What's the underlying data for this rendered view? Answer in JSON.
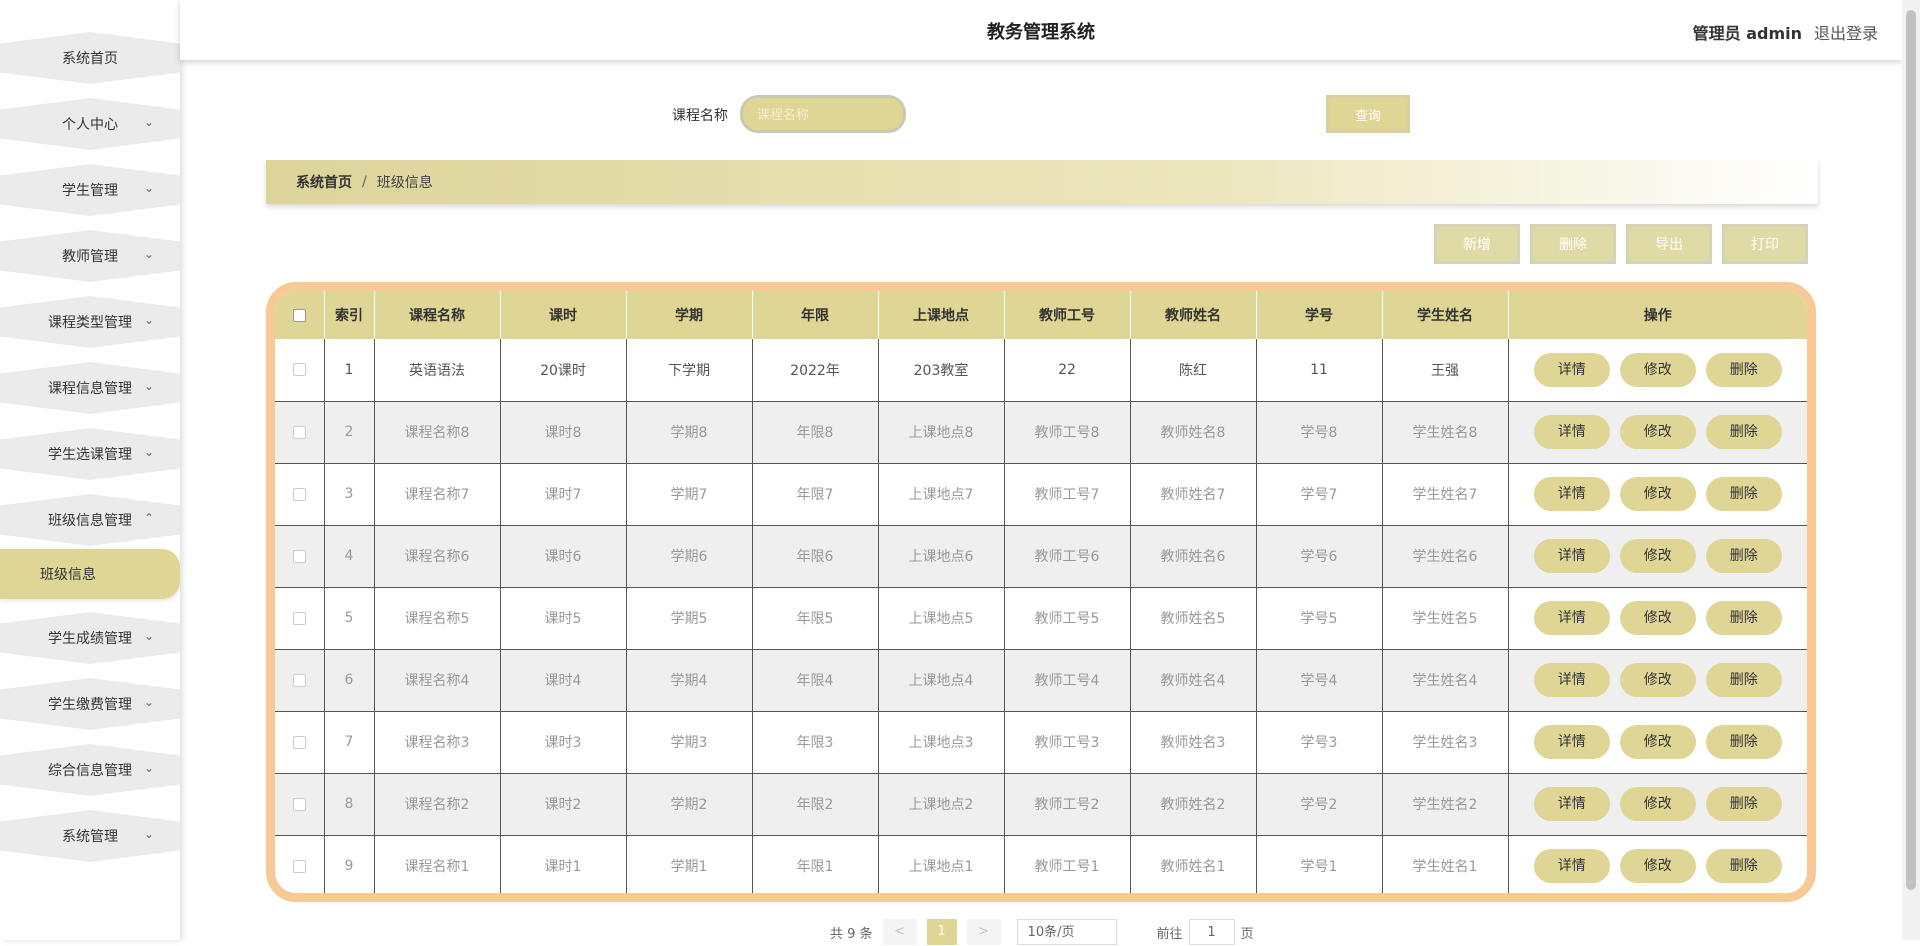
{
  "header": {
    "title": "教务管理系统",
    "admin": "管理员 admin",
    "logout": "退出登录"
  },
  "sidebar": {
    "items": [
      {
        "label": "系统首页",
        "chevron": ""
      },
      {
        "label": "个人中心",
        "chevron": "⌄"
      },
      {
        "label": "学生管理",
        "chevron": "⌄"
      },
      {
        "label": "教师管理",
        "chevron": "⌄"
      },
      {
        "label": "课程类型管理",
        "chevron": "⌄"
      },
      {
        "label": "课程信息管理",
        "chevron": "⌄"
      },
      {
        "label": "学生选课管理",
        "chevron": "⌄"
      },
      {
        "label": "班级信息管理",
        "chevron": "⌃"
      },
      {
        "label": "学生成绩管理",
        "chevron": "⌄"
      },
      {
        "label": "学生缴费管理",
        "chevron": "⌄"
      },
      {
        "label": "综合信息管理",
        "chevron": "⌄"
      },
      {
        "label": "系统管理",
        "chevron": "⌄"
      }
    ],
    "active_sub": "班级信息"
  },
  "search": {
    "label": "课程名称",
    "placeholder": "课程名称",
    "value": "",
    "button": "查询"
  },
  "breadcrumb": {
    "home": "系统首页",
    "sep": "/",
    "current": "班级信息"
  },
  "toolbar": {
    "add": "新增",
    "delete": "删除",
    "export": "导出",
    "print": "打印"
  },
  "table": {
    "columns": [
      "索引",
      "课程名称",
      "课时",
      "学期",
      "年限",
      "上课地点",
      "教师工号",
      "教师姓名",
      "学号",
      "学生姓名",
      "操作"
    ],
    "rows": [
      [
        "1",
        "英语语法",
        "20课时",
        "下学期",
        "2022年",
        "203教室",
        "22",
        "陈红",
        "11",
        "王强"
      ],
      [
        "2",
        "课程名称8",
        "课时8",
        "学期8",
        "年限8",
        "上课地点8",
        "教师工号8",
        "教师姓名8",
        "学号8",
        "学生姓名8"
      ],
      [
        "3",
        "课程名称7",
        "课时7",
        "学期7",
        "年限7",
        "上课地点7",
        "教师工号7",
        "教师姓名7",
        "学号7",
        "学生姓名7"
      ],
      [
        "4",
        "课程名称6",
        "课时6",
        "学期6",
        "年限6",
        "上课地点6",
        "教师工号6",
        "教师姓名6",
        "学号6",
        "学生姓名6"
      ],
      [
        "5",
        "课程名称5",
        "课时5",
        "学期5",
        "年限5",
        "上课地点5",
        "教师工号5",
        "教师姓名5",
        "学号5",
        "学生姓名5"
      ],
      [
        "6",
        "课程名称4",
        "课时4",
        "学期4",
        "年限4",
        "上课地点4",
        "教师工号4",
        "教师姓名4",
        "学号4",
        "学生姓名4"
      ],
      [
        "7",
        "课程名称3",
        "课时3",
        "学期3",
        "年限3",
        "上课地点3",
        "教师工号3",
        "教师姓名3",
        "学号3",
        "学生姓名3"
      ],
      [
        "8",
        "课程名称2",
        "课时2",
        "学期2",
        "年限2",
        "上课地点2",
        "教师工号2",
        "教师姓名2",
        "学号2",
        "学生姓名2"
      ],
      [
        "9",
        "课程名称1",
        "课时1",
        "学期1",
        "年限1",
        "上课地点1",
        "教师工号1",
        "教师姓名1",
        "学号1",
        "学生姓名1"
      ]
    ],
    "actions": [
      "详情",
      "修改",
      "删除"
    ]
  },
  "pagination": {
    "total": "共 9 条",
    "prev": "<",
    "page": "1",
    "next": ">",
    "page_size": "10条/页",
    "goto_prefix": "前往",
    "goto_value": "1",
    "goto_suffix": "页"
  },
  "colors": {
    "accent": "#dfd595",
    "table_border": "#f6c995"
  }
}
